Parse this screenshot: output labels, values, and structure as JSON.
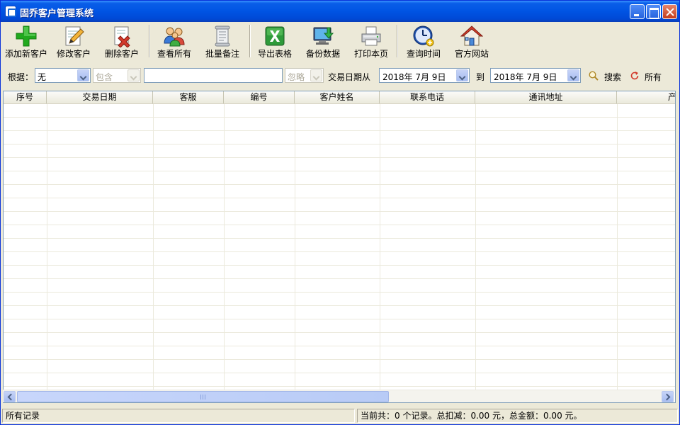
{
  "window": {
    "title": "固乔客户管理系统"
  },
  "toolbar": {
    "items": [
      {
        "label": "添加新客户",
        "icon": "add-plus-icon"
      },
      {
        "label": "修改客户",
        "icon": "edit-pencil-icon"
      },
      {
        "label": "删除客户",
        "icon": "delete-doc-icon"
      },
      {
        "label": "查看所有",
        "icon": "users-group-icon"
      },
      {
        "label": "批量备注",
        "icon": "scroll-note-icon"
      },
      {
        "label": "导出表格",
        "icon": "excel-export-icon"
      },
      {
        "label": "备份数据",
        "icon": "monitor-backup-icon"
      },
      {
        "label": "打印本页",
        "icon": "printer-icon"
      },
      {
        "label": "查询时间",
        "icon": "clock-icon"
      },
      {
        "label": "官方网站",
        "icon": "house-icon"
      }
    ]
  },
  "search": {
    "basis_label": "根据：",
    "basis_value": "无",
    "match_value": "包含",
    "keyword_value": "",
    "ignore_value": "忽略",
    "date_from_label": "交易日期从",
    "date_from": "2018年 7月 9日",
    "date_to_label": "到",
    "date_to": "2018年 7月 9日",
    "search_label": "搜索",
    "all_label": "所有"
  },
  "grid": {
    "columns": [
      "序号",
      "交易日期",
      "客服",
      "编号",
      "客户姓名",
      "联系电话",
      "通讯地址",
      "产"
    ]
  },
  "status": {
    "left": "所有记录",
    "right": "当前共：0 个记录。总扣减：0.00 元，总金额：0.00 元。"
  },
  "colors": {
    "titlebar": "#0054e3",
    "chrome": "#ece9d8",
    "accent_green": "#21a91e",
    "accent_red": "#d23a2c"
  }
}
